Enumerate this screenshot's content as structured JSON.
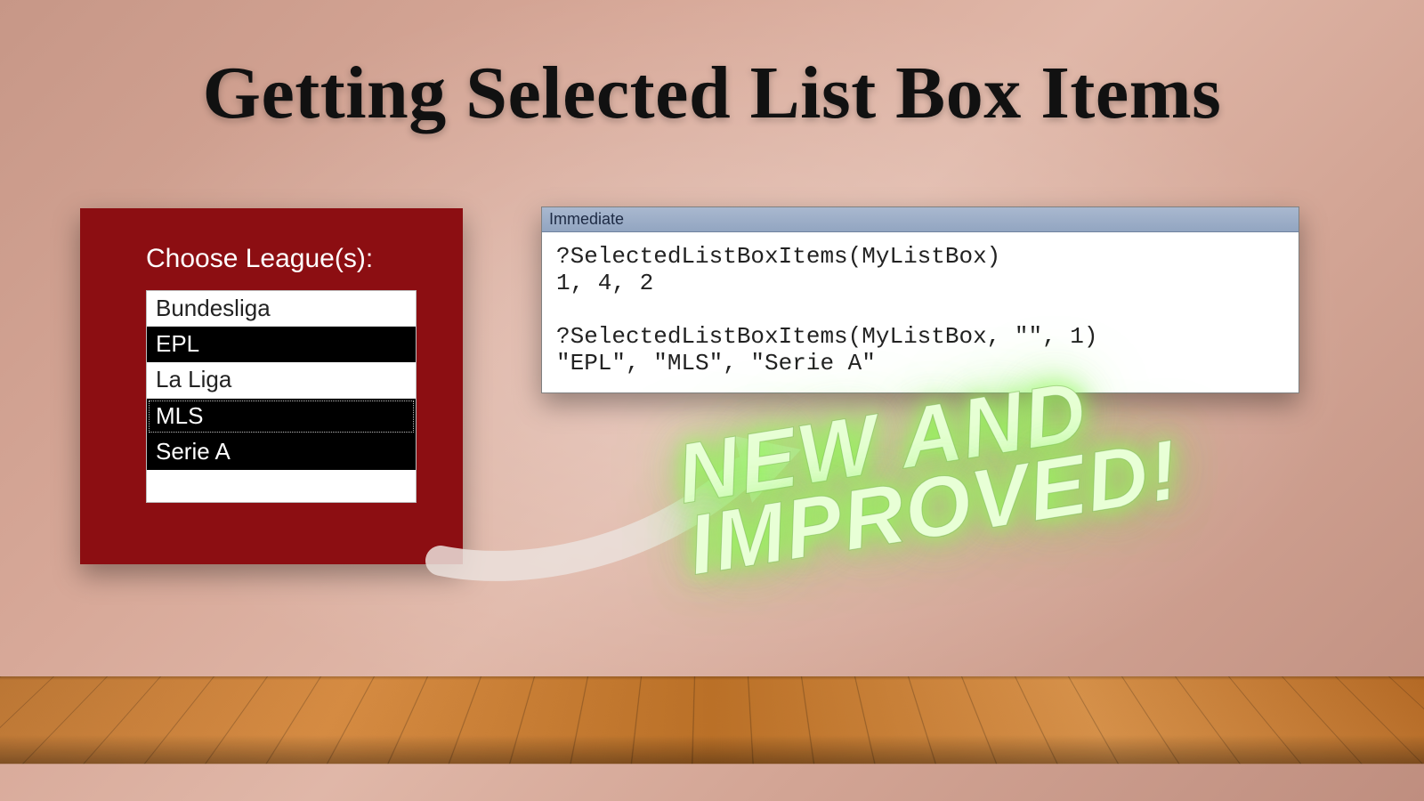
{
  "title": "Getting Selected List Box Items",
  "listbox": {
    "label": "Choose League(s):",
    "items": [
      {
        "text": "Bundesliga",
        "selected": false,
        "focus": false
      },
      {
        "text": "EPL",
        "selected": true,
        "focus": false
      },
      {
        "text": "La Liga",
        "selected": false,
        "focus": false
      },
      {
        "text": "MLS",
        "selected": true,
        "focus": true
      },
      {
        "text": "Serie A",
        "selected": true,
        "focus": false
      }
    ]
  },
  "immediate": {
    "title": "Immediate",
    "lines": [
      "?SelectedListBoxItems(MyListBox)",
      "1, 4, 2",
      "",
      "?SelectedListBoxItems(MyListBox, \"\", 1)",
      "\"EPL\", \"MLS\", \"Serie A\""
    ]
  },
  "badge": "NEW AND\nIMPROVED!"
}
